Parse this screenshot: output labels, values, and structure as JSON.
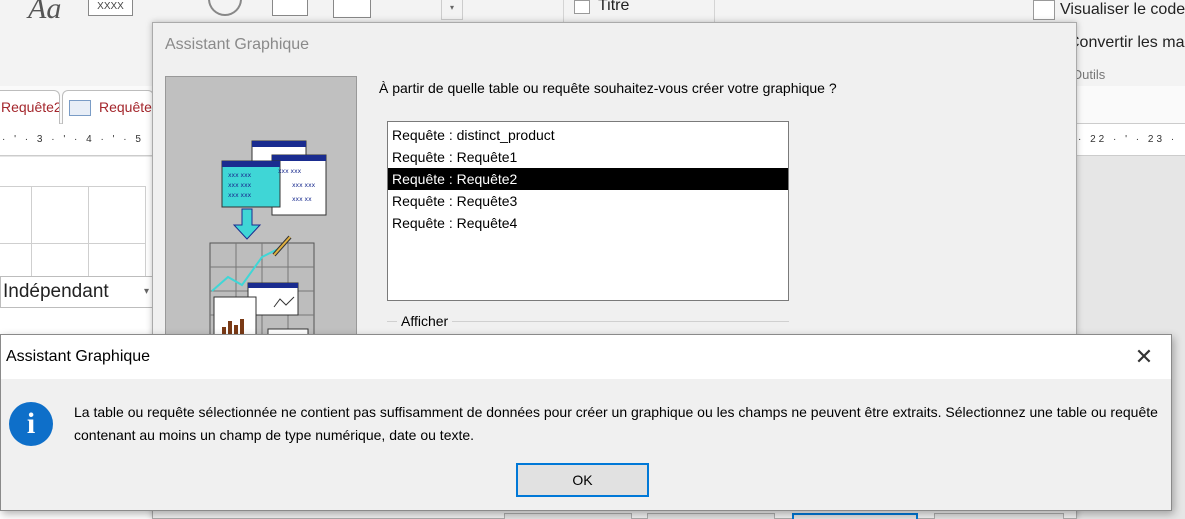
{
  "ribbon": {
    "font_sample": "Aa",
    "placeholder_sample": "XXXX",
    "title_label": "Titre",
    "view_code_label": "Visualiser le code",
    "convert_label": "Convertir les macros",
    "tools_group": "Outils"
  },
  "doc_tabs": [
    {
      "label": "Requête2"
    },
    {
      "label": "Requête"
    }
  ],
  "ruler": {
    "left_text": "· ' · 3 · ' · 4 · ' · 5",
    "right_text": "· 22 · ' · 23 ·"
  },
  "design": {
    "property_value": "Indépendant"
  },
  "wizard": {
    "title": "Assistant Graphique",
    "question": "À partir de quelle table ou requête souhaitez-vous créer votre graphique ?",
    "list_items": [
      {
        "label": "Requête : distinct_product",
        "selected": false
      },
      {
        "label": "Requête : Requête1",
        "selected": false
      },
      {
        "label": "Requête : Requête2",
        "selected": true
      },
      {
        "label": "Requête : Requête3",
        "selected": false
      },
      {
        "label": "Requête : Requête4",
        "selected": false
      }
    ],
    "show_group_label": "Afficher"
  },
  "message_box": {
    "title": "Assistant Graphique",
    "message": "La table ou requête sélectionnée ne contient pas suffisamment de données pour créer un graphique ou les champs ne peuvent être extraits. Sélectionnez une table ou requête contenant au moins un champ de type numérique, date ou texte.",
    "ok_label": "OK",
    "icon": "info-icon",
    "close_icon": "close-icon"
  },
  "colors": {
    "selection": "#000000",
    "accent": "#0078d7",
    "info_icon": "#0e6fc9",
    "tab_text": "#a4262c"
  }
}
